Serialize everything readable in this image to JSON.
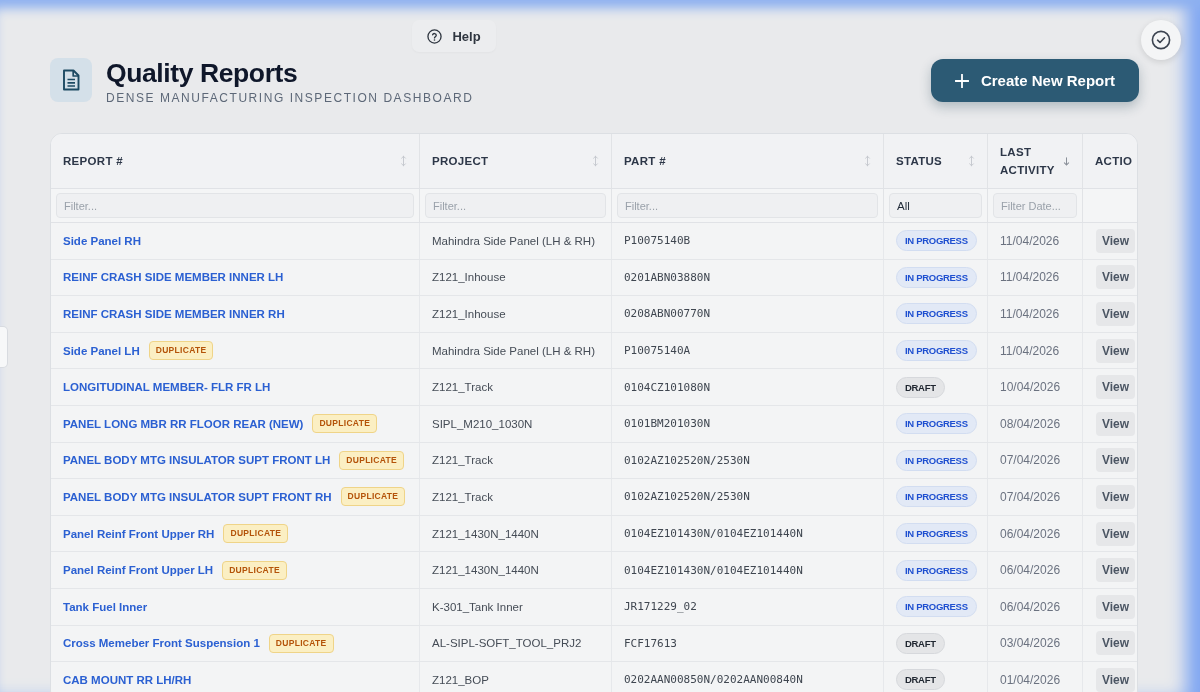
{
  "header": {
    "help": "Help",
    "title": "Quality Reports",
    "subtitle": "DENSE MANUFACTURING INSPECTION DASHBOARD",
    "create_button": "Create New Report"
  },
  "table": {
    "columns": [
      {
        "label": "REPORT #",
        "sortable": true,
        "sorted": false,
        "filter": {
          "kind": "text",
          "placeholder": "Filter..."
        }
      },
      {
        "label": "PROJECT",
        "sortable": true,
        "sorted": false,
        "filter": {
          "kind": "text",
          "placeholder": "Filter..."
        }
      },
      {
        "label": "PART #",
        "sortable": true,
        "sorted": false,
        "filter": {
          "kind": "text",
          "placeholder": "Filter..."
        }
      },
      {
        "label": "STATUS",
        "sortable": true,
        "sorted": false,
        "filter": {
          "kind": "select",
          "value": "All"
        }
      },
      {
        "label": "LAST ACTIVITY",
        "sortable": true,
        "sorted": true,
        "filter": {
          "kind": "date",
          "placeholder": "Filter Date..."
        }
      },
      {
        "label": "ACTIO"
      }
    ],
    "rows": [
      {
        "report": {
          "title": "Side Panel RH"
        },
        "project": "Mahindra Side Panel (LH & RH)",
        "part": "P10075140B",
        "status": {
          "label": "IN PROGRESS",
          "kind": "in_progress"
        },
        "last_activity": "11/04/2026",
        "action": "View"
      },
      {
        "report": {
          "title": "REINF CRASH SIDE MEMBER INNER LH"
        },
        "project": "Z121_Inhouse",
        "part": "0201ABN03880N",
        "status": {
          "label": "IN PROGRESS",
          "kind": "in_progress"
        },
        "last_activity": "11/04/2026",
        "action": "View"
      },
      {
        "report": {
          "title": "REINF CRASH SIDE MEMBER INNER RH"
        },
        "project": "Z121_Inhouse",
        "part": "0208ABN00770N",
        "status": {
          "label": "IN PROGRESS",
          "kind": "in_progress"
        },
        "last_activity": "11/04/2026",
        "action": "View"
      },
      {
        "report": {
          "title": "Side Panel LH",
          "badge": "DUPLICATE"
        },
        "project": "Mahindra Side Panel (LH & RH)",
        "part": "P10075140A",
        "status": {
          "label": "IN PROGRESS",
          "kind": "in_progress"
        },
        "last_activity": "11/04/2026",
        "action": "View"
      },
      {
        "report": {
          "title": "LONGITUDINAL MEMBER- FLR FR LH"
        },
        "project": "Z121_Track",
        "part": "0104CZ101080N",
        "status": {
          "label": "DRAFT",
          "kind": "draft"
        },
        "last_activity": "10/04/2026",
        "action": "View"
      },
      {
        "report": {
          "title": "PANEL LONG MBR RR FLOOR REAR (NEW)",
          "badge": "DUPLICATE"
        },
        "project": "SIPL_M210_1030N",
        "part": "0101BM201030N",
        "status": {
          "label": "IN PROGRESS",
          "kind": "in_progress"
        },
        "last_activity": "08/04/2026",
        "action": "View"
      },
      {
        "report": {
          "title": "PANEL BODY MTG INSULATOR SUPT FRONT LH",
          "badge": "DUPLICATE"
        },
        "project": "Z121_Track",
        "part": "0102AZ102520N/2530N",
        "status": {
          "label": "IN PROGRESS",
          "kind": "in_progress"
        },
        "last_activity": "07/04/2026",
        "action": "View"
      },
      {
        "report": {
          "title": "PANEL BODY MTG INSULATOR SUPT FRONT RH",
          "badge": "DUPLICATE"
        },
        "project": "Z121_Track",
        "part": "0102AZ102520N/2530N",
        "status": {
          "label": "IN PROGRESS",
          "kind": "in_progress"
        },
        "last_activity": "07/04/2026",
        "action": "View"
      },
      {
        "report": {
          "title": "Panel Reinf Front Upper RH",
          "badge": "DUPLICATE"
        },
        "project": "Z121_1430N_1440N",
        "part": "0104EZ101430N/0104EZ101440N",
        "status": {
          "label": "IN PROGRESS",
          "kind": "in_progress"
        },
        "last_activity": "06/04/2026",
        "action": "View"
      },
      {
        "report": {
          "title": "Panel Reinf Front Upper LH",
          "badge": "DUPLICATE"
        },
        "project": "Z121_1430N_1440N",
        "part": "0104EZ101430N/0104EZ101440N",
        "status": {
          "label": "IN PROGRESS",
          "kind": "in_progress"
        },
        "last_activity": "06/04/2026",
        "action": "View"
      },
      {
        "report": {
          "title": "Tank Fuel Inner"
        },
        "project": "K-301_Tank Inner",
        "part": "JR171229_02",
        "status": {
          "label": "IN PROGRESS",
          "kind": "in_progress"
        },
        "last_activity": "06/04/2026",
        "action": "View"
      },
      {
        "report": {
          "title": "Cross Memeber Front Suspension 1",
          "badge": "DUPLICATE"
        },
        "project": "AL-SIPL-SOFT_TOOL_PRJ2",
        "part": "FCF17613",
        "status": {
          "label": "DRAFT",
          "kind": "draft"
        },
        "last_activity": "03/04/2026",
        "action": "View"
      },
      {
        "report": {
          "title": "CAB MOUNT RR LH/RH"
        },
        "project": "Z121_BOP",
        "part": "0202AAN00850N/0202AAN00840N",
        "status": {
          "label": "DRAFT",
          "kind": "draft"
        },
        "last_activity": "01/04/2026",
        "action": "View"
      }
    ]
  }
}
